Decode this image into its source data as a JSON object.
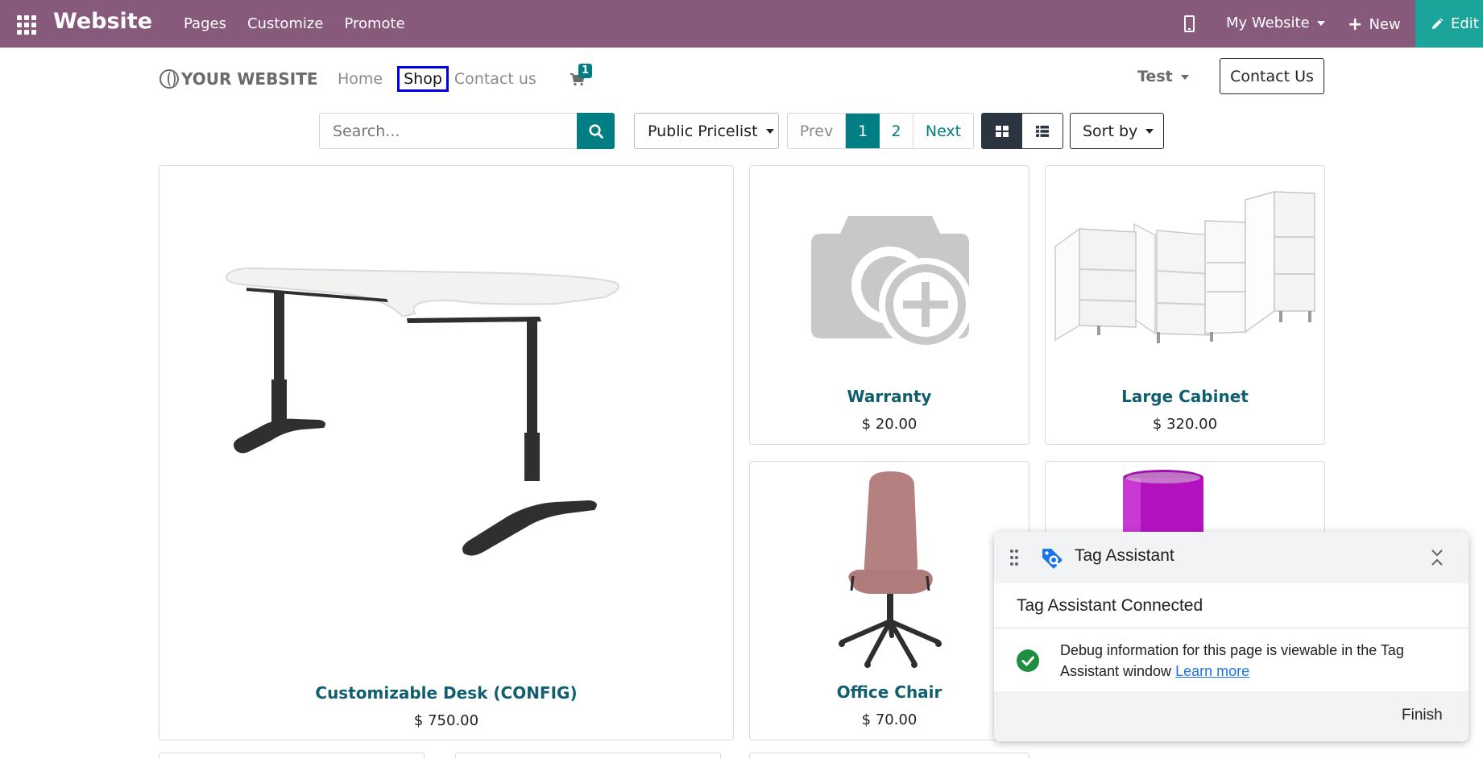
{
  "admin_bar": {
    "brand": "Website",
    "menu": [
      "Pages",
      "Customize",
      "Promote"
    ],
    "site_selector": "My Website",
    "new_label": "New",
    "edit_label": "Edit",
    "colors": {
      "bar": "#875a7b",
      "edit": "#1aa49a"
    }
  },
  "site_header": {
    "logo_text": "YOUR WEBSITE",
    "nav": {
      "home": "Home",
      "shop": "Shop",
      "contact": "Contact us"
    },
    "cart_count": "1",
    "user_menu": "Test",
    "contact_button": "Contact Us"
  },
  "toolbar": {
    "search_placeholder": "Search...",
    "pricelist": "Public Pricelist",
    "pager": {
      "prev": "Prev",
      "page1": "1",
      "page2": "2",
      "next": "Next"
    },
    "sort_by": "Sort by",
    "accent": "#017e84"
  },
  "products": [
    {
      "name": "Customizable Desk (CONFIG)",
      "price": "$ 750.00"
    },
    {
      "name": "Warranty",
      "price": "$ 20.00"
    },
    {
      "name": "Large Cabinet",
      "price": "$ 320.00"
    },
    {
      "name": "Office Chair",
      "price": "$ 70.00"
    }
  ],
  "tag_assistant": {
    "title": "Tag Assistant",
    "status": "Tag Assistant Connected",
    "message": "Debug information for this page is viewable in the Tag Assistant window",
    "link": "Learn more",
    "finish": "Finish"
  }
}
